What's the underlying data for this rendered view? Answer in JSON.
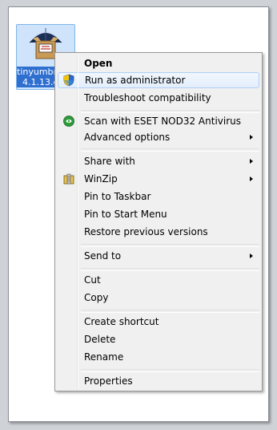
{
  "desktop": {
    "icon": {
      "name_line1": "tinyumbrella-",
      "name_line2": "4.1.13.exe",
      "glyph": "umbrella-box-icon"
    }
  },
  "context_menu": {
    "items": [
      {
        "label": "Open",
        "bold": true
      },
      {
        "label": "Run as administrator",
        "icon": "uac-shield-icon",
        "highlighted": true
      },
      {
        "label": "Troubleshoot compatibility"
      },
      {
        "label": "Scan with ESET NOD32 Antivirus",
        "icon": "eset-icon"
      },
      {
        "label": "Advanced options",
        "submenu": true
      },
      {
        "label": "Share with",
        "submenu": true
      },
      {
        "label": "WinZip",
        "icon": "winzip-icon",
        "submenu": true
      },
      {
        "label": "Pin to Taskbar"
      },
      {
        "label": "Pin to Start Menu"
      },
      {
        "label": "Restore previous versions"
      },
      {
        "label": "Send to",
        "submenu": true
      },
      {
        "label": "Cut"
      },
      {
        "label": "Copy"
      },
      {
        "label": "Create shortcut"
      },
      {
        "label": "Delete"
      },
      {
        "label": "Rename"
      },
      {
        "label": "Properties"
      }
    ]
  },
  "colors": {
    "menu_bg": "#f0f0f0",
    "highlight_border": "#aecff7",
    "selection_blue": "#2f6fd0"
  }
}
